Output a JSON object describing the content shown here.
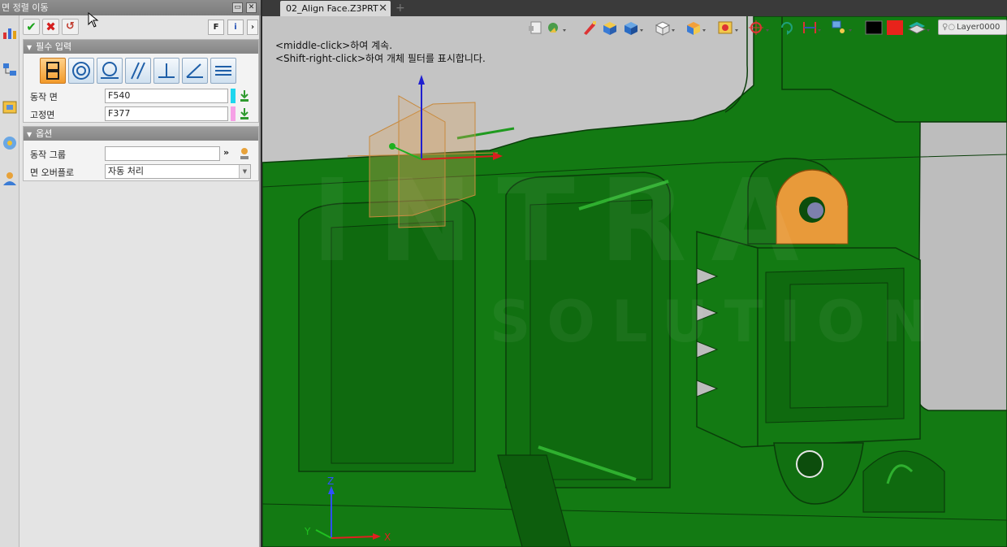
{
  "panel": {
    "title": "면 정렬 이동",
    "title_btn_minimize": "▭",
    "title_btn_close": "✕",
    "toolbar": {
      "ok": "✔",
      "cancel": "✖",
      "apply": "↺",
      "filter": "F",
      "info": "i"
    },
    "required": {
      "header": "필수 입력",
      "moving_face_label": "동작 면",
      "moving_face_value": "F540",
      "fixed_face_label": "고정면",
      "fixed_face_value": "F377"
    },
    "options": {
      "header": "옵션",
      "motion_group_label": "동작 그룹",
      "motion_group_value": "",
      "face_overflow_label": "면 오버플로",
      "face_overflow_value": "자동 처리"
    }
  },
  "viewport": {
    "tab_title": "02_Align Face.Z3PRT",
    "tab_close": "✕",
    "tab_add": "+",
    "hint_line_1": "<middle-click>하여 계속.",
    "hint_line_2": "<Shift-right-click>하여 개체 필터를 표시합니다.",
    "layer_name": "Layer0000",
    "axis_x": "X",
    "axis_y": "Y",
    "axis_z": "Z"
  },
  "colors": {
    "part_green": "#137a13",
    "selected_face": "#e89a3a",
    "chip_cyan": "#1ed6ee",
    "chip_pink": "#f6a0e6",
    "swatch_black": "#000000",
    "swatch_red": "#e8231b"
  }
}
